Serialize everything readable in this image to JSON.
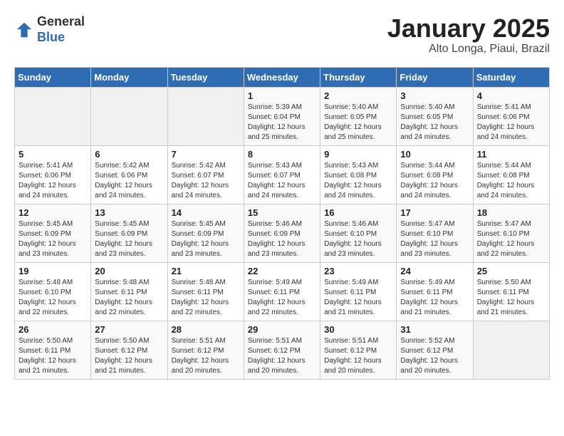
{
  "header": {
    "logo_line1": "General",
    "logo_line2": "Blue",
    "title": "January 2025",
    "subtitle": "Alto Longa, Piaui, Brazil"
  },
  "weekdays": [
    "Sunday",
    "Monday",
    "Tuesday",
    "Wednesday",
    "Thursday",
    "Friday",
    "Saturday"
  ],
  "weeks": [
    [
      {
        "day": "",
        "sunrise": "",
        "sunset": "",
        "daylight": ""
      },
      {
        "day": "",
        "sunrise": "",
        "sunset": "",
        "daylight": ""
      },
      {
        "day": "",
        "sunrise": "",
        "sunset": "",
        "daylight": ""
      },
      {
        "day": "1",
        "sunrise": "Sunrise: 5:39 AM",
        "sunset": "Sunset: 6:04 PM",
        "daylight": "Daylight: 12 hours and 25 minutes."
      },
      {
        "day": "2",
        "sunrise": "Sunrise: 5:40 AM",
        "sunset": "Sunset: 6:05 PM",
        "daylight": "Daylight: 12 hours and 25 minutes."
      },
      {
        "day": "3",
        "sunrise": "Sunrise: 5:40 AM",
        "sunset": "Sunset: 6:05 PM",
        "daylight": "Daylight: 12 hours and 24 minutes."
      },
      {
        "day": "4",
        "sunrise": "Sunrise: 5:41 AM",
        "sunset": "Sunset: 6:06 PM",
        "daylight": "Daylight: 12 hours and 24 minutes."
      }
    ],
    [
      {
        "day": "5",
        "sunrise": "Sunrise: 5:41 AM",
        "sunset": "Sunset: 6:06 PM",
        "daylight": "Daylight: 12 hours and 24 minutes."
      },
      {
        "day": "6",
        "sunrise": "Sunrise: 5:42 AM",
        "sunset": "Sunset: 6:06 PM",
        "daylight": "Daylight: 12 hours and 24 minutes."
      },
      {
        "day": "7",
        "sunrise": "Sunrise: 5:42 AM",
        "sunset": "Sunset: 6:07 PM",
        "daylight": "Daylight: 12 hours and 24 minutes."
      },
      {
        "day": "8",
        "sunrise": "Sunrise: 5:43 AM",
        "sunset": "Sunset: 6:07 PM",
        "daylight": "Daylight: 12 hours and 24 minutes."
      },
      {
        "day": "9",
        "sunrise": "Sunrise: 5:43 AM",
        "sunset": "Sunset: 6:08 PM",
        "daylight": "Daylight: 12 hours and 24 minutes."
      },
      {
        "day": "10",
        "sunrise": "Sunrise: 5:44 AM",
        "sunset": "Sunset: 6:08 PM",
        "daylight": "Daylight: 12 hours and 24 minutes."
      },
      {
        "day": "11",
        "sunrise": "Sunrise: 5:44 AM",
        "sunset": "Sunset: 6:08 PM",
        "daylight": "Daylight: 12 hours and 24 minutes."
      }
    ],
    [
      {
        "day": "12",
        "sunrise": "Sunrise: 5:45 AM",
        "sunset": "Sunset: 6:09 PM",
        "daylight": "Daylight: 12 hours and 23 minutes."
      },
      {
        "day": "13",
        "sunrise": "Sunrise: 5:45 AM",
        "sunset": "Sunset: 6:09 PM",
        "daylight": "Daylight: 12 hours and 23 minutes."
      },
      {
        "day": "14",
        "sunrise": "Sunrise: 5:45 AM",
        "sunset": "Sunset: 6:09 PM",
        "daylight": "Daylight: 12 hours and 23 minutes."
      },
      {
        "day": "15",
        "sunrise": "Sunrise: 5:46 AM",
        "sunset": "Sunset: 6:09 PM",
        "daylight": "Daylight: 12 hours and 23 minutes."
      },
      {
        "day": "16",
        "sunrise": "Sunrise: 5:46 AM",
        "sunset": "Sunset: 6:10 PM",
        "daylight": "Daylight: 12 hours and 23 minutes."
      },
      {
        "day": "17",
        "sunrise": "Sunrise: 5:47 AM",
        "sunset": "Sunset: 6:10 PM",
        "daylight": "Daylight: 12 hours and 23 minutes."
      },
      {
        "day": "18",
        "sunrise": "Sunrise: 5:47 AM",
        "sunset": "Sunset: 6:10 PM",
        "daylight": "Daylight: 12 hours and 22 minutes."
      }
    ],
    [
      {
        "day": "19",
        "sunrise": "Sunrise: 5:48 AM",
        "sunset": "Sunset: 6:10 PM",
        "daylight": "Daylight: 12 hours and 22 minutes."
      },
      {
        "day": "20",
        "sunrise": "Sunrise: 5:48 AM",
        "sunset": "Sunset: 6:11 PM",
        "daylight": "Daylight: 12 hours and 22 minutes."
      },
      {
        "day": "21",
        "sunrise": "Sunrise: 5:48 AM",
        "sunset": "Sunset: 6:11 PM",
        "daylight": "Daylight: 12 hours and 22 minutes."
      },
      {
        "day": "22",
        "sunrise": "Sunrise: 5:49 AM",
        "sunset": "Sunset: 6:11 PM",
        "daylight": "Daylight: 12 hours and 22 minutes."
      },
      {
        "day": "23",
        "sunrise": "Sunrise: 5:49 AM",
        "sunset": "Sunset: 6:11 PM",
        "daylight": "Daylight: 12 hours and 21 minutes."
      },
      {
        "day": "24",
        "sunrise": "Sunrise: 5:49 AM",
        "sunset": "Sunset: 6:11 PM",
        "daylight": "Daylight: 12 hours and 21 minutes."
      },
      {
        "day": "25",
        "sunrise": "Sunrise: 5:50 AM",
        "sunset": "Sunset: 6:11 PM",
        "daylight": "Daylight: 12 hours and 21 minutes."
      }
    ],
    [
      {
        "day": "26",
        "sunrise": "Sunrise: 5:50 AM",
        "sunset": "Sunset: 6:11 PM",
        "daylight": "Daylight: 12 hours and 21 minutes."
      },
      {
        "day": "27",
        "sunrise": "Sunrise: 5:50 AM",
        "sunset": "Sunset: 6:12 PM",
        "daylight": "Daylight: 12 hours and 21 minutes."
      },
      {
        "day": "28",
        "sunrise": "Sunrise: 5:51 AM",
        "sunset": "Sunset: 6:12 PM",
        "daylight": "Daylight: 12 hours and 20 minutes."
      },
      {
        "day": "29",
        "sunrise": "Sunrise: 5:51 AM",
        "sunset": "Sunset: 6:12 PM",
        "daylight": "Daylight: 12 hours and 20 minutes."
      },
      {
        "day": "30",
        "sunrise": "Sunrise: 5:51 AM",
        "sunset": "Sunset: 6:12 PM",
        "daylight": "Daylight: 12 hours and 20 minutes."
      },
      {
        "day": "31",
        "sunrise": "Sunrise: 5:52 AM",
        "sunset": "Sunset: 6:12 PM",
        "daylight": "Daylight: 12 hours and 20 minutes."
      },
      {
        "day": "",
        "sunrise": "",
        "sunset": "",
        "daylight": ""
      }
    ]
  ]
}
